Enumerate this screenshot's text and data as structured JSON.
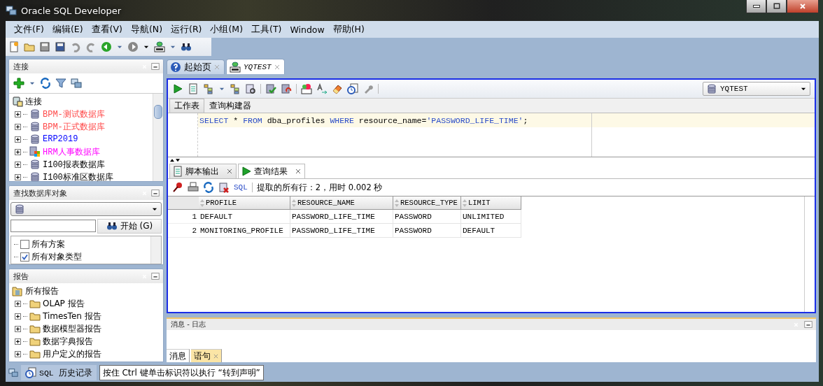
{
  "window": {
    "title": "Oracle SQL Developer"
  },
  "menu": [
    "文件(F)",
    "编辑(E)",
    "查看(V)",
    "导航(N)",
    "运行(R)",
    "小组(M)",
    "工具(T)",
    "Window",
    "帮助(H)"
  ],
  "connections_panel": {
    "title": "连接",
    "root": {
      "label": "连接",
      "children": [
        {
          "label": "BPM-测试数据库",
          "color": "#ff4a4a",
          "expanded": false
        },
        {
          "label": "BPM-正式数据库",
          "color": "#ff4a4a",
          "expanded": false
        },
        {
          "label": "ERP2019",
          "color": "#0000ff",
          "expanded": false
        },
        {
          "label": "HRM人事数据库",
          "color": "#ff00ff",
          "expanded": false
        },
        {
          "label": "I100报表数据库",
          "color": "#000000",
          "expanded": false
        },
        {
          "label": "I100标准区数据库",
          "color": "#000000",
          "expanded": false
        }
      ]
    }
  },
  "find_panel": {
    "title": "查找数据库对象",
    "go_button": "开始 (G)",
    "items": [
      {
        "label": "所有方案",
        "checked": false
      },
      {
        "label": "所有对象类型",
        "checked": true
      }
    ]
  },
  "reports_panel": {
    "title": "报告",
    "root": {
      "label": "所有报告",
      "children": [
        {
          "label": "OLAP 报告",
          "expanded": false
        },
        {
          "label": "TimesTen 报告",
          "expanded": false
        },
        {
          "label": "数据模型器报告",
          "expanded": false
        },
        {
          "label": "数据字典报告",
          "expanded": false
        },
        {
          "label": "用户定义的报告",
          "expanded": false
        }
      ]
    }
  },
  "editor_tabs": [
    {
      "label": "起始页",
      "selected": false,
      "kind": "help"
    },
    {
      "label": "YQTEST",
      "selected": true,
      "kind": "sql"
    }
  ],
  "connection_select": "YQTEST",
  "sheet_tabs": [
    {
      "label": "工作表",
      "selected": true
    },
    {
      "label": "查询构建器",
      "selected": false
    }
  ],
  "sql": [
    {
      "kind": "keyword",
      "text": "SELECT"
    },
    {
      "kind": "plain",
      "text": " * "
    },
    {
      "kind": "keyword",
      "text": "FROM"
    },
    {
      "kind": "plain",
      "text": " dba_profiles "
    },
    {
      "kind": "keyword",
      "text": "WHERE"
    },
    {
      "kind": "plain",
      "text": " resource_name="
    },
    {
      "kind": "string",
      "text": "'PASSWORD_LIFE_TIME'"
    },
    {
      "kind": "plain",
      "text": ";"
    }
  ],
  "result_tabs": [
    {
      "label": "脚本输出",
      "selected": false,
      "kind": "script"
    },
    {
      "label": "查询结果",
      "selected": true,
      "kind": "query"
    }
  ],
  "result_toolbar": {
    "sql_link": "SQL",
    "status": "提取的所有行：2，用时 0.002 秒"
  },
  "table": {
    "columns": [
      "PROFILE",
      "RESOURCE_NAME",
      "RESOURCE_TYPE",
      "LIMIT"
    ],
    "rows": [
      {
        "number": "1",
        "cells": [
          "DEFAULT",
          "PASSWORD_LIFE_TIME",
          "PASSWORD",
          "UNLIMITED"
        ]
      },
      {
        "number": "2",
        "cells": [
          "MONITORING_PROFILE",
          "PASSWORD_LIFE_TIME",
          "PASSWORD",
          "DEFAULT"
        ]
      }
    ]
  },
  "log_panel": {
    "title": "消息 - 日志",
    "tabs": [
      {
        "label": "消息",
        "selected": false
      },
      {
        "label": "语句",
        "selected": true
      }
    ]
  },
  "status_bar": {
    "history_tab": "SQL 历史记录",
    "hint": "按住 Ctrl 键单击标识符以执行 “转到声明”"
  }
}
